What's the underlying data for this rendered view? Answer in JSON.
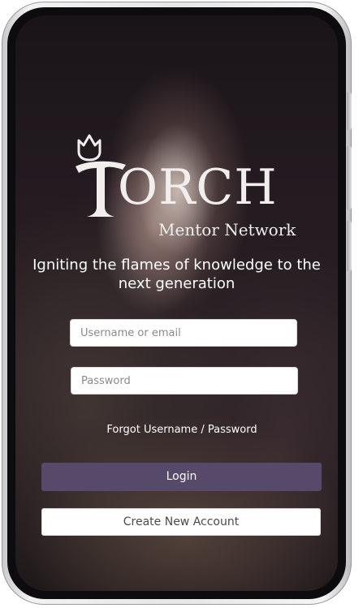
{
  "app": {
    "logo_text": "ORCH",
    "logo_subtitle": "Mentor Network",
    "tagline": "Igniting the flames of knowledge to the next generation"
  },
  "form": {
    "username_placeholder": "Username or email",
    "password_placeholder": "Password",
    "forgot_link": "Forgot Username / Password",
    "login_label": "Login",
    "create_label": "Create New Account"
  },
  "colors": {
    "login_button": "#57496a",
    "text_on_dark": "#ffffff"
  },
  "icons": {
    "logo_mark": "tulip-torch-icon"
  }
}
